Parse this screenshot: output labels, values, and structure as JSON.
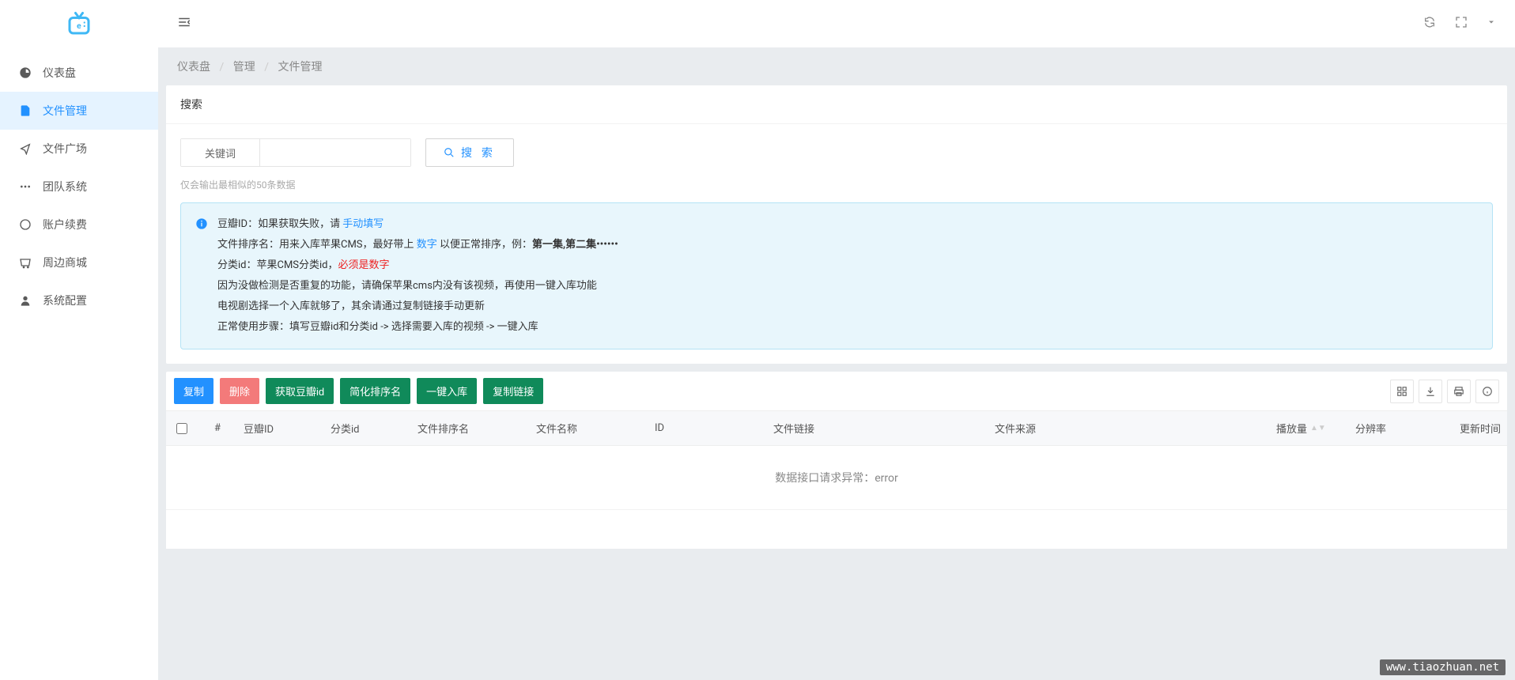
{
  "sidebar": {
    "items": [
      {
        "icon": "dashboard",
        "label": "仪表盘"
      },
      {
        "icon": "file",
        "label": "文件管理"
      },
      {
        "icon": "share",
        "label": "文件广场"
      },
      {
        "icon": "team",
        "label": "团队系统"
      },
      {
        "icon": "renew",
        "label": "账户续费"
      },
      {
        "icon": "shop",
        "label": "周边商城"
      },
      {
        "icon": "settings",
        "label": "系统配置"
      }
    ]
  },
  "breadcrumb": {
    "items": [
      "仪表盘",
      "管理",
      "文件管理"
    ]
  },
  "search": {
    "title": "搜索",
    "keyword_label": "关键词",
    "keyword_value": "",
    "button": "搜 索",
    "hint": "仅会输出最相似的50条数据"
  },
  "alert": {
    "line1_prefix": "豆瓣ID：如果获取失败，请 ",
    "line1_link": "手动填写",
    "line2_prefix": "文件排序名：用来入库苹果CMS，最好带上 ",
    "line2_blue": "数字",
    "line2_mid": " 以便正常排序，例：",
    "line2_bold": "第一集,第二集••••••",
    "line3_prefix": "分类id：苹果CMS分类id，",
    "line3_red": "必须是数字",
    "line4": "因为没做检测是否重复的功能，请确保苹果cms内没有该视频，再使用一键入库功能",
    "line5": "电视剧选择一个入库就够了，其余请通过复制链接手动更新",
    "line6": "正常使用步骤：填写豆瓣id和分类id -> 选择需要入库的视频 -> 一键入库"
  },
  "actions": {
    "copy": "复制",
    "delete": "删除",
    "get_douban": "获取豆瓣id",
    "simplify": "简化排序名",
    "import": "一键入库",
    "copy_link": "复制链接"
  },
  "table": {
    "headers": {
      "idx": "#",
      "douban_id": "豆瓣ID",
      "cat_id": "分类id",
      "sort_name": "文件排序名",
      "file_name": "文件名称",
      "id": "ID",
      "file_link": "文件链接",
      "source": "文件来源",
      "play_count": "播放量",
      "resolution": "分辨率",
      "update_time": "更新时间"
    },
    "empty": "数据接口请求异常：error"
  },
  "watermark": "www.tiaozhuan.net"
}
